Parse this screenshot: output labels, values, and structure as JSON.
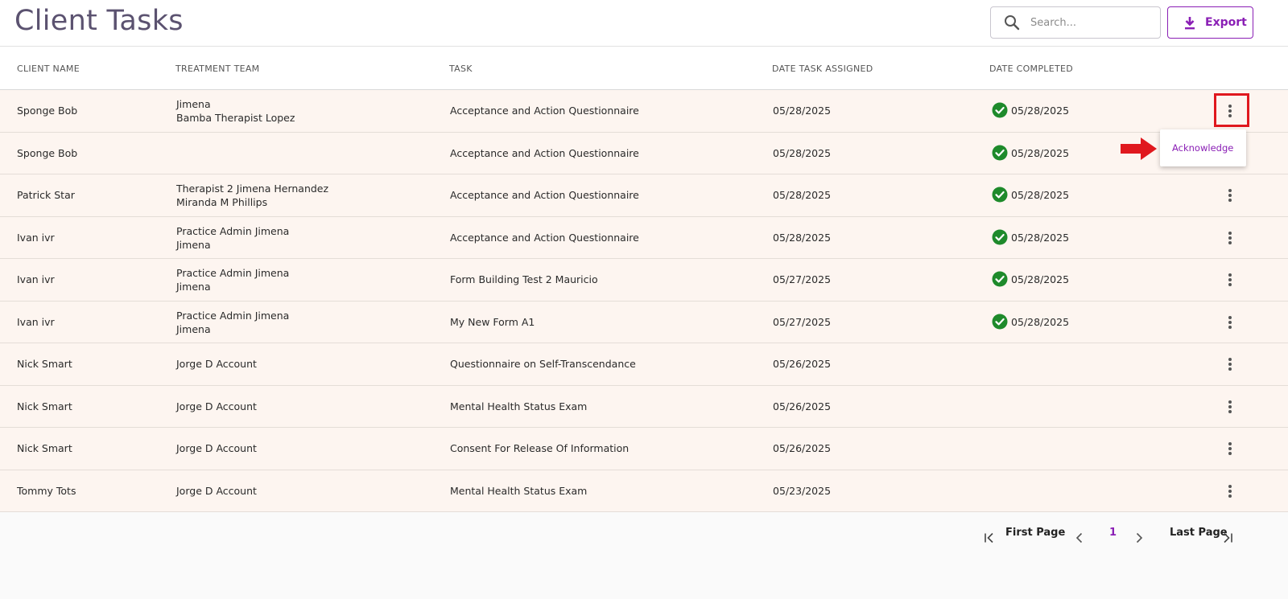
{
  "page": {
    "title": "Client Tasks"
  },
  "search": {
    "placeholder": "Search...",
    "value": ""
  },
  "export": {
    "label": "Export"
  },
  "table": {
    "headers": [
      "CLIENT NAME",
      "TREATMENT TEAM",
      "TASK",
      "DATE TASK ASSIGNED",
      "DATE COMPLETED"
    ],
    "rows": [
      {
        "client": "Sponge Bob",
        "team": [
          "Jimena",
          "Bamba Therapist Lopez"
        ],
        "task": "Acceptance and Action Questionnaire",
        "assigned": "05/28/2025",
        "completed": "05/28/2025"
      },
      {
        "client": "Sponge Bob",
        "team": [],
        "task": "Acceptance and Action Questionnaire",
        "assigned": "05/28/2025",
        "completed": "05/28/2025"
      },
      {
        "client": "Patrick Star",
        "team": [
          "Therapist 2 Jimena Hernandez",
          "Miranda M Phillips"
        ],
        "task": "Acceptance and Action Questionnaire",
        "assigned": "05/28/2025",
        "completed": "05/28/2025"
      },
      {
        "client": "Ivan ivr",
        "team": [
          "Practice Admin Jimena",
          "Jimena"
        ],
        "task": "Acceptance and Action Questionnaire",
        "assigned": "05/28/2025",
        "completed": "05/28/2025"
      },
      {
        "client": "Ivan ivr",
        "team": [
          "Practice Admin Jimena",
          "Jimena"
        ],
        "task": "Form Building Test 2 Mauricio",
        "assigned": "05/27/2025",
        "completed": "05/28/2025"
      },
      {
        "client": "Ivan ivr",
        "team": [
          "Practice Admin Jimena",
          "Jimena"
        ],
        "task": "My New Form A1",
        "assigned": "05/27/2025",
        "completed": "05/28/2025"
      },
      {
        "client": "Nick Smart",
        "team": [
          "Jorge D Account"
        ],
        "task": "Questionnaire on Self-Transcendance",
        "assigned": "05/26/2025",
        "completed": ""
      },
      {
        "client": "Nick Smart",
        "team": [
          "Jorge D Account"
        ],
        "task": "Mental Health Status Exam",
        "assigned": "05/26/2025",
        "completed": ""
      },
      {
        "client": "Nick Smart",
        "team": [
          "Jorge D Account"
        ],
        "task": "Consent For Release Of Information",
        "assigned": "05/26/2025",
        "completed": ""
      },
      {
        "client": "Tommy Tots",
        "team": [
          "Jorge D Account"
        ],
        "task": "Mental Health Status Exam",
        "assigned": "05/23/2025",
        "completed": ""
      }
    ]
  },
  "row_menu": {
    "open_row": 1,
    "items": [
      "Acknowledge"
    ]
  },
  "pagination": {
    "first_label": "First Page",
    "last_label": "Last Page",
    "current_page": "1"
  },
  "colors": {
    "accent": "#8a1fb5",
    "title": "#5b5270",
    "row_bg": "#fdf5f0",
    "check": "#1e8a2b",
    "highlight": "#e0181e"
  },
  "icons": {
    "search": "search-icon",
    "export": "download-icon",
    "completed": "check-circle-icon",
    "row_actions": "more-vert-icon",
    "annotation": "arrow-right-icon"
  }
}
